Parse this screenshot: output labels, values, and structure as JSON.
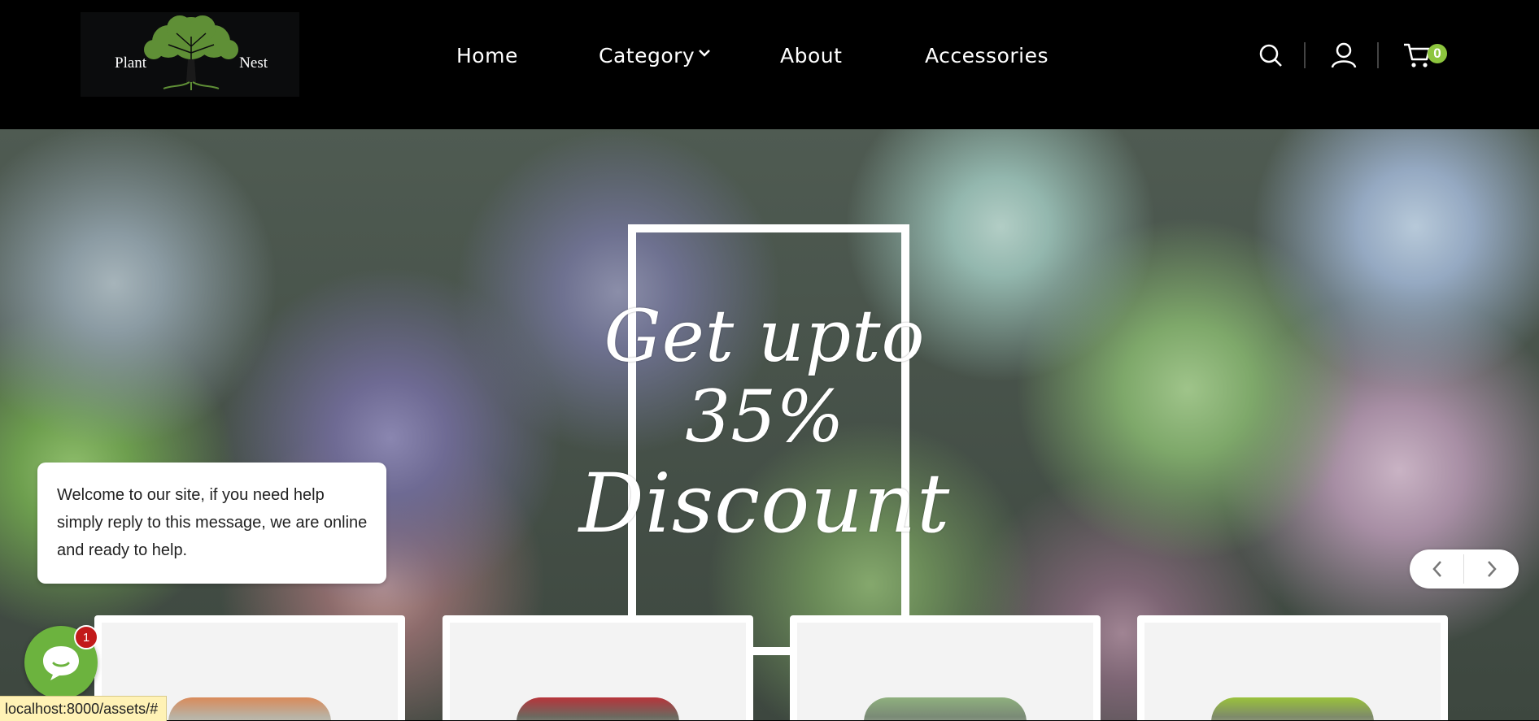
{
  "brand": {
    "logo_text_left": "Plant",
    "logo_text_right": "Nest"
  },
  "nav": {
    "home": "Home",
    "category": "Category",
    "about": "About",
    "accessories": "Accessories"
  },
  "header_icons": {
    "search": "search-icon",
    "account": "user-icon",
    "cart": "cart-icon",
    "cart_count": "0"
  },
  "hero": {
    "line1": "Get upto",
    "line2": "35%",
    "line3": "Discount"
  },
  "slider": {
    "prev": "‹",
    "next": "›"
  },
  "chat": {
    "message": "Welcome to our site, if you need help simply reply to this message, we are online and ready to help.",
    "unread": "1"
  },
  "status_url": "localhost:8000/assets/#",
  "colors": {
    "accent": "#8dc53e",
    "chat": "#6cb33e",
    "badge": "#c21a1a"
  }
}
